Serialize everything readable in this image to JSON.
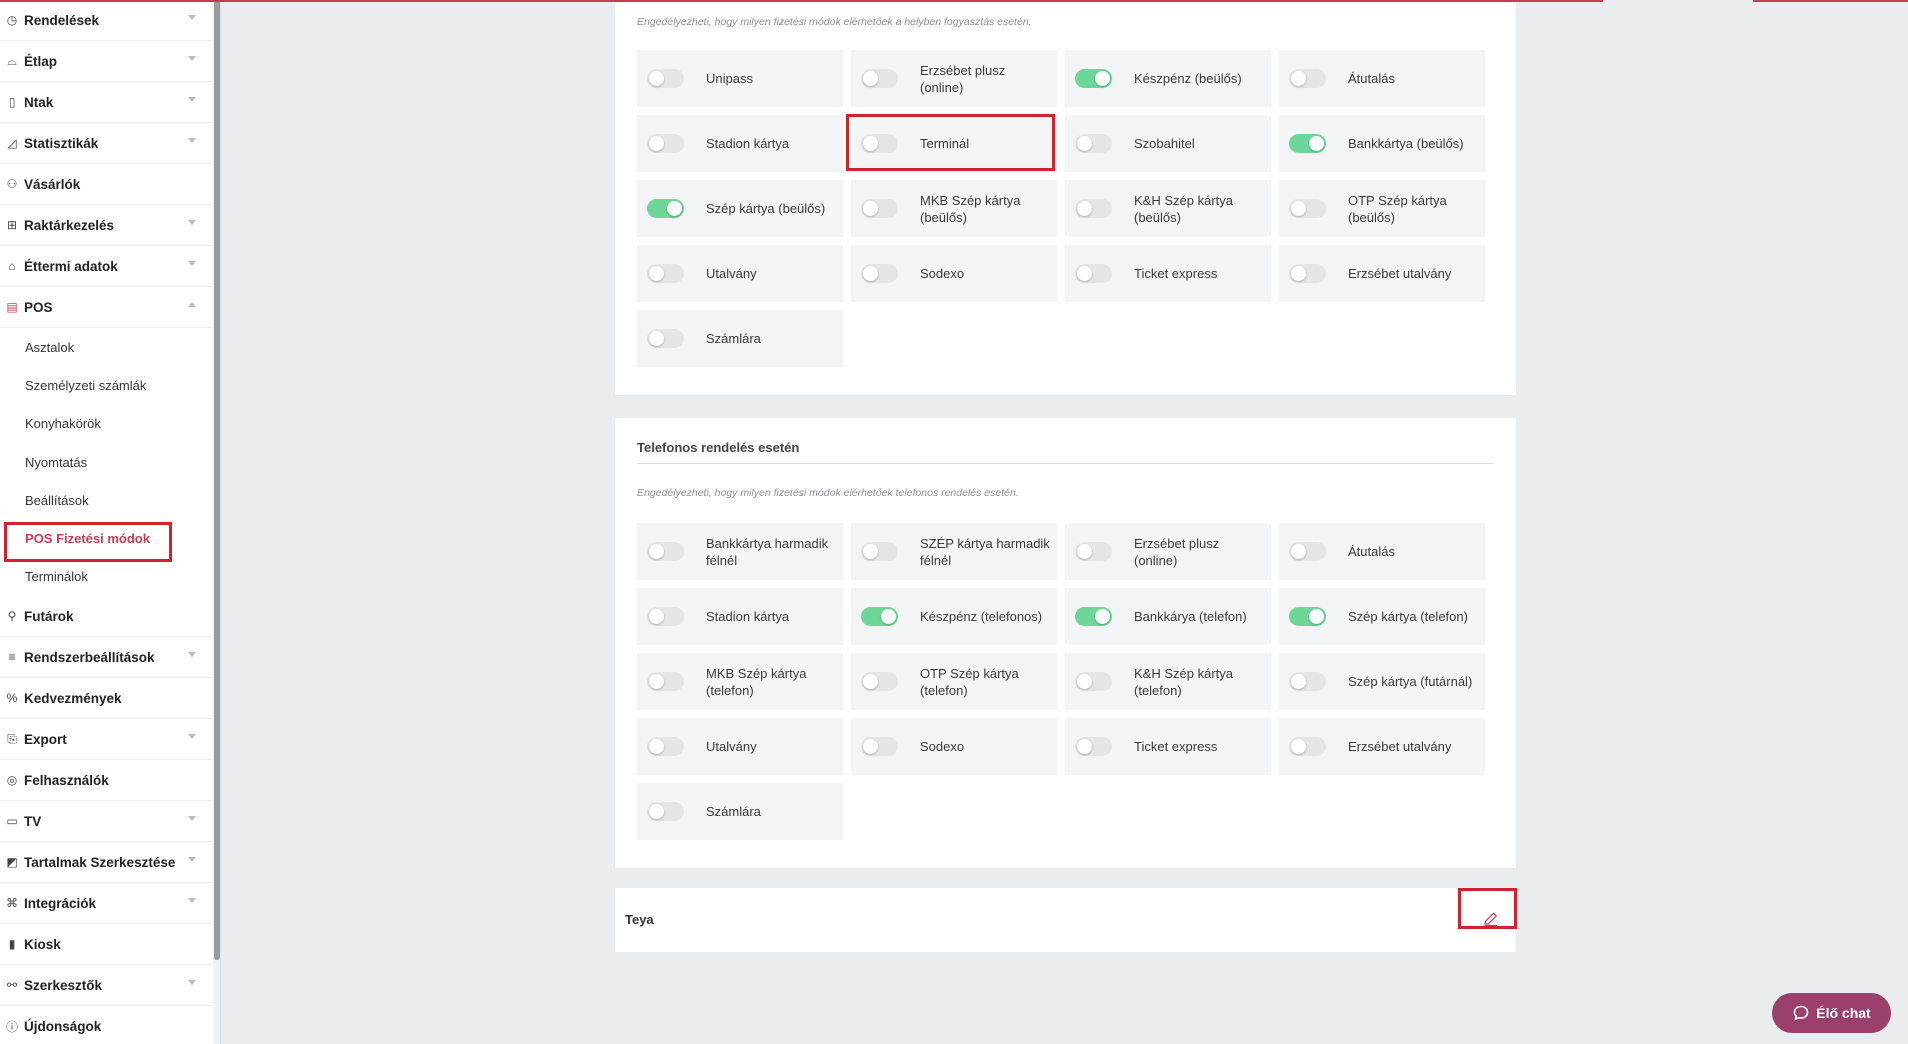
{
  "sidebar": {
    "items": [
      {
        "label": "Rendelések",
        "icon": "clock-icon",
        "chevron": true
      },
      {
        "label": "Étlap",
        "icon": "dish-icon",
        "chevron": true
      },
      {
        "label": "Ntak",
        "icon": "document-icon",
        "chevron": true
      },
      {
        "label": "Statisztikák",
        "icon": "chart-icon",
        "chevron": true
      },
      {
        "label": "Vásárlók",
        "icon": "users-icon",
        "chevron": false
      },
      {
        "label": "Raktárkezelés",
        "icon": "boxes-icon",
        "chevron": true
      },
      {
        "label": "Éttermi adatok",
        "icon": "store-icon",
        "chevron": true
      },
      {
        "label": "POS",
        "icon": "pos-icon",
        "chevron": "up"
      }
    ],
    "pos_sub": [
      "Asztalok",
      "Személyzeti számlák",
      "Konyhakörök",
      "Nyomtatás",
      "Beállítások",
      "POS Fizetési módok",
      "Terminálok"
    ],
    "items_after": [
      {
        "label": "Futárok",
        "icon": "scooter-icon",
        "chevron": false
      },
      {
        "label": "Rendszerbeállítások",
        "icon": "sliders-icon",
        "chevron": true
      },
      {
        "label": "Kedvezmények",
        "icon": "percent-icon",
        "chevron": false
      },
      {
        "label": "Export",
        "icon": "export-icon",
        "chevron": true
      },
      {
        "label": "Felhasználók",
        "icon": "user-circle-icon",
        "chevron": false
      },
      {
        "label": "TV",
        "icon": "monitor-icon",
        "chevron": true
      },
      {
        "label": "Tartalmak Szerkesztése",
        "icon": "edit-content-icon",
        "chevron": true
      },
      {
        "label": "Integrációk",
        "icon": "plug-icon",
        "chevron": true
      },
      {
        "label": "Kiosk",
        "icon": "kiosk-icon",
        "chevron": false
      },
      {
        "label": "Szerkesztők",
        "icon": "nodes-icon",
        "chevron": true
      },
      {
        "label": "Újdonságok",
        "icon": "info-icon",
        "chevron": false
      }
    ]
  },
  "section1": {
    "hint": "Engedélyezheti, hogy milyen fizetési módok elérhetőek a helyben fogyasztás esetén.",
    "tiles": [
      {
        "label": "Unipass",
        "on": false
      },
      {
        "label": "Erzsébet plusz (online)",
        "on": false
      },
      {
        "label": "Készpénz (beülős)",
        "on": true
      },
      {
        "label": "Átutalás",
        "on": false
      },
      {
        "label": "Stadion kártya",
        "on": false
      },
      {
        "label": "Terminál",
        "on": false
      },
      {
        "label": "Szobahitel",
        "on": false
      },
      {
        "label": "Bankkártya (beülős)",
        "on": true
      },
      {
        "label": "Szép kártya (beülős)",
        "on": true
      },
      {
        "label": "MKB Szép kártya (beülős)",
        "on": false
      },
      {
        "label": "K&H Szép kártya (beülős)",
        "on": false
      },
      {
        "label": "OTP Szép kártya (beülős)",
        "on": false
      },
      {
        "label": "Utalvány",
        "on": false
      },
      {
        "label": "Sodexo",
        "on": false
      },
      {
        "label": "Ticket express",
        "on": false
      },
      {
        "label": "Erzsébet utalvány",
        "on": false
      },
      {
        "label": "Számlára",
        "on": false
      }
    ]
  },
  "section2": {
    "title": "Telefonos rendelés esetén",
    "hint": "Engedélyezheti, hogy milyen fizetési módok elérhetőek telefonos rendelés esetén.",
    "tiles": [
      {
        "label": "Bankkártya harmadik félnél",
        "on": false
      },
      {
        "label": "SZÉP kártya harmadik félnél",
        "on": false
      },
      {
        "label": "Erzsébet plusz (online)",
        "on": false
      },
      {
        "label": "Átutalás",
        "on": false
      },
      {
        "label": "Stadion kártya",
        "on": false
      },
      {
        "label": "Készpénz (telefonos)",
        "on": true
      },
      {
        "label": "Bankkárya (telefon)",
        "on": true
      },
      {
        "label": "Szép kártya (telefon)",
        "on": true
      },
      {
        "label": "MKB Szép kártya (telefon)",
        "on": false
      },
      {
        "label": "OTP Szép kártya (telefon)",
        "on": false
      },
      {
        "label": "K&H Szép kártya (telefon)",
        "on": false
      },
      {
        "label": "Szép kártya (futárnál)",
        "on": false
      },
      {
        "label": "Utalvány",
        "on": false
      },
      {
        "label": "Sodexo",
        "on": false
      },
      {
        "label": "Ticket express",
        "on": false
      },
      {
        "label": "Erzsébet utalvány",
        "on": false
      },
      {
        "label": "Számlára",
        "on": false
      }
    ]
  },
  "teya": {
    "label": "Teya"
  },
  "chat": {
    "label": "Élő chat"
  },
  "colors": {
    "accent": "#c93b55",
    "toggle_on": "#6dd79a",
    "chat": "#9b3f6c",
    "highlight": "#d0232f"
  }
}
